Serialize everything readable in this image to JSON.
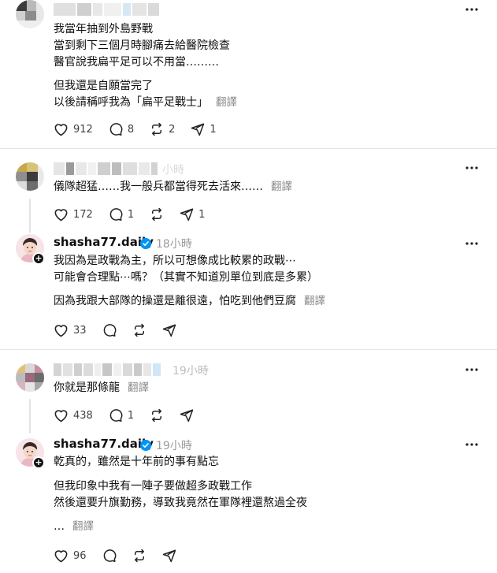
{
  "post1": {
    "lines": [
      "我當年抽到外島野戰",
      "當到剩下三個月時腳痛去給醫院檢查",
      "醫官說我扁平足可以不用當………",
      "但我還是自願當完了",
      "以後請稱呼我為「扁平足戰士」"
    ],
    "translate": "翻譯",
    "likes": "912",
    "replies": "8",
    "reposts": "2",
    "shares": "1"
  },
  "post2": {
    "time": "小時",
    "lines": [
      "儀隊超猛……我一般兵都當得死去活來……"
    ],
    "translate": "翻譯",
    "likes": "172",
    "replies": "1",
    "shares": "1"
  },
  "post3": {
    "username": "shasha77.daily",
    "time": "18小時",
    "lines": [
      "我因為是政戰為主，所以可想像成比較累的政戰⋯",
      "可能會合理點⋯嗎？（其實不知道別單位到底是多累）",
      "因為我跟大部隊的操還是離很遠，怕吃到他們豆腐"
    ],
    "translate": "翻譯",
    "likes": "33"
  },
  "post4": {
    "time": "19小時",
    "lines": [
      "你就是那條龍"
    ],
    "translate": "翻譯",
    "likes": "438",
    "replies": "1"
  },
  "post5": {
    "username": "shasha77.daily",
    "time": "19小時",
    "lines": [
      "乾真的，雖然是十年前的事有點忘",
      "但我印象中我有一陣子要做超多政戰工作",
      "然後還要升旗勤務，導致我竟然在軍隊裡還熬過全夜",
      "…"
    ],
    "translate": "翻譯",
    "likes": "96"
  },
  "colors": {
    "verified": "#0095f6",
    "divider": "#e5e5e5",
    "muted": "#9a9a9a"
  },
  "icons": [
    "heart-icon",
    "comment-icon",
    "repost-icon",
    "share-icon",
    "more-icon",
    "verified-icon",
    "follow-plus-icon"
  ]
}
